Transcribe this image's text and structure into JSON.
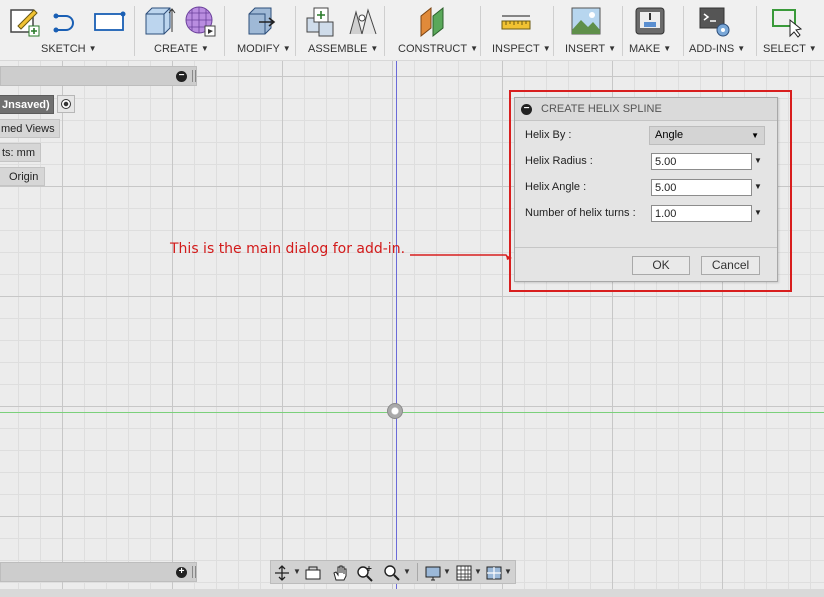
{
  "toolbar": {
    "groups": [
      {
        "label": "SKETCH"
      },
      {
        "label": "CREATE"
      },
      {
        "label": "MODIFY"
      },
      {
        "label": "ASSEMBLE"
      },
      {
        "label": "CONSTRUCT"
      },
      {
        "label": "INSPECT"
      },
      {
        "label": "INSERT"
      },
      {
        "label": "MAKE"
      },
      {
        "label": "ADD-INS"
      },
      {
        "label": "SELECT"
      }
    ]
  },
  "browser": {
    "nodes": {
      "document": "Jnsaved)",
      "named_views": "med Views",
      "units": "ts: mm",
      "origin": "Origin"
    }
  },
  "dialog": {
    "title": "CREATE HELIX SPLINE",
    "fields": {
      "helix_by": {
        "label": "Helix By :",
        "value": "Angle"
      },
      "helix_radius": {
        "label": "Helix Radius :",
        "value": "5.00"
      },
      "helix_angle": {
        "label": "Helix Angle :",
        "value": "5.00"
      },
      "helix_turns": {
        "label": "Number of helix turns :",
        "value": "1.00"
      }
    },
    "ok_label": "OK",
    "cancel_label": "Cancel"
  },
  "annotation": {
    "text": "This is the main dialog for add-in.",
    "color": "#d21a1a"
  },
  "icons": {
    "toolbar": [
      "sketch-create-icon",
      "arc-icon",
      "rectangle-icon",
      "box-icon",
      "form-icon",
      "press-pull-icon",
      "new-component-icon",
      "joint-icon",
      "offset-plane-icon",
      "measure-icon",
      "insert-image-icon",
      "3d-print-icon",
      "scripts-addins-icon",
      "select-icon"
    ],
    "navbar": [
      "orbit-icon",
      "look-at-icon",
      "pan-icon",
      "zoom-icon",
      "fit-icon",
      "display-settings-icon",
      "grid-settings-icon",
      "viewports-icon"
    ]
  }
}
